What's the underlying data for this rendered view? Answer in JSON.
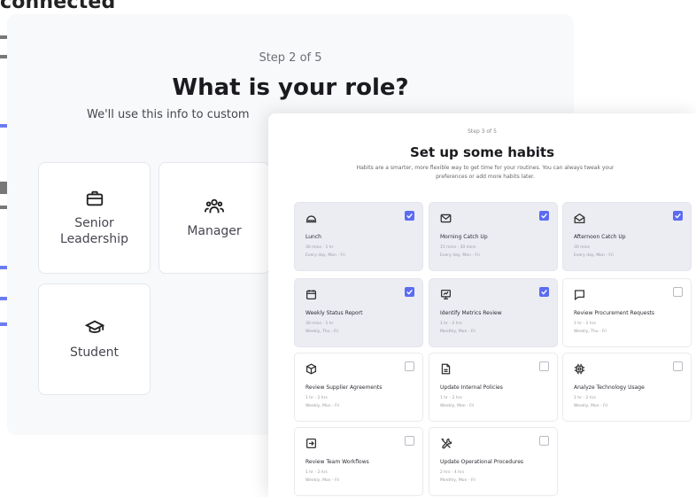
{
  "background_page": {
    "title": "connected"
  },
  "role_step": {
    "step_label": "Step 2 of 5",
    "title": "What is your role?",
    "subtitle": "We'll use this info to custom",
    "roles": [
      {
        "label": "Senior Leadership",
        "icon": "briefcase-icon"
      },
      {
        "label": "Manager",
        "icon": "people-icon"
      },
      {
        "label": "Student",
        "icon": "graduation-cap-icon"
      }
    ]
  },
  "habits_step": {
    "step_label": "Step 3 of 5",
    "title": "Set up some habits",
    "description": "Habits are a smarter, more flexible way to get time for your routines. You can always tweak your preferences or add more habits later.",
    "accent_color": "#5b6cf2",
    "habits": [
      {
        "name": "Lunch",
        "duration": "30 mins - 1 hr",
        "schedule": "Every day, Mon - Fri",
        "icon": "lunch-icon",
        "checked": true
      },
      {
        "name": "Morning Catch Up",
        "duration": "15 mins - 30 mins",
        "schedule": "Every day, Mon - Fri",
        "icon": "mail-icon",
        "checked": true
      },
      {
        "name": "Afternoon Catch Up",
        "duration": "30 mins",
        "schedule": "Every day, Mon - Fri",
        "icon": "mail-open-icon",
        "checked": true
      },
      {
        "name": "Weekly Status Report",
        "duration": "30 mins - 1 hr",
        "schedule": "Weekly, Thu - Fri",
        "icon": "calendar-icon",
        "checked": true
      },
      {
        "name": "Identify Metrics Review",
        "duration": "1 hr - 2 hrs",
        "schedule": "Monthly, Mon - Fri",
        "icon": "monitor-icon",
        "checked": true
      },
      {
        "name": "Review Procurement Requests",
        "duration": "1 hr - 2 hrs",
        "schedule": "Weekly, Thu - Fri",
        "icon": "chat-icon",
        "checked": false
      },
      {
        "name": "Review Supplier Agreements",
        "duration": "1 hr - 2 hrs",
        "schedule": "Weekly, Mon - Fri",
        "icon": "box-icon",
        "checked": false
      },
      {
        "name": "Update Internal Policies",
        "duration": "1 hr - 2 hrs",
        "schedule": "Weekly, Mon - Fri",
        "icon": "document-icon",
        "checked": false
      },
      {
        "name": "Analyze Technology Usage",
        "duration": "1 hr - 2 hrs",
        "schedule": "Weekly, Mon - Fri",
        "icon": "chip-icon",
        "checked": false
      },
      {
        "name": "Review Team Workflows",
        "duration": "1 hr - 2 hrs",
        "schedule": "Weekly, Mon - Fri",
        "icon": "login-icon",
        "checked": false
      },
      {
        "name": "Update Operational Procedures",
        "duration": "2 hrs - 4 hrs",
        "schedule": "Monthly, Mon - Fri",
        "icon": "tools-icon",
        "checked": false
      }
    ]
  }
}
